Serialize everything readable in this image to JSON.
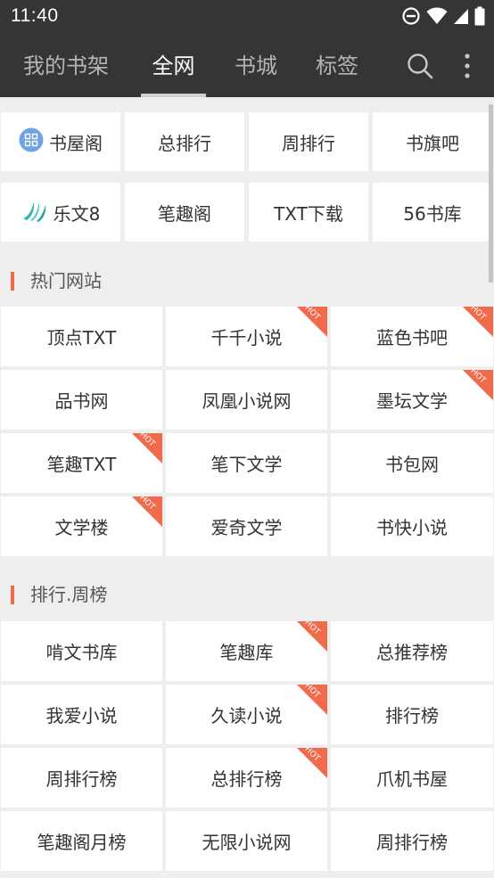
{
  "status": {
    "time": "11:40"
  },
  "tabs": [
    {
      "label": "我的书架"
    },
    {
      "label": "全网"
    },
    {
      "label": "书城"
    },
    {
      "label": "标签"
    }
  ],
  "top_sources": [
    {
      "label": "书屋阁",
      "logo": "grid-logo-icon"
    },
    {
      "label": "总排行"
    },
    {
      "label": "周排行"
    },
    {
      "label": "书旗吧"
    },
    {
      "label": "乐文8",
      "logo": "leaf-logo-icon"
    },
    {
      "label": "笔趣阁"
    },
    {
      "label": "TXT下载"
    },
    {
      "label": "56书库"
    }
  ],
  "sections": [
    {
      "title": "热门网站",
      "items": [
        {
          "label": "顶点TXT",
          "hot": false
        },
        {
          "label": "千千小说",
          "hot": true
        },
        {
          "label": "蓝色书吧",
          "hot": true
        },
        {
          "label": "品书网",
          "hot": false
        },
        {
          "label": "凤凰小说网",
          "hot": false
        },
        {
          "label": "墨坛文学",
          "hot": true
        },
        {
          "label": "笔趣TXT",
          "hot": true
        },
        {
          "label": "笔下文学",
          "hot": false
        },
        {
          "label": "书包网",
          "hot": false
        },
        {
          "label": "文学楼",
          "hot": true
        },
        {
          "label": "爱奇文学",
          "hot": false
        },
        {
          "label": "书快小说",
          "hot": false
        }
      ]
    },
    {
      "title": "排行.周榜",
      "items": [
        {
          "label": "啃文书库",
          "hot": false
        },
        {
          "label": "笔趣库",
          "hot": true
        },
        {
          "label": "总推荐榜",
          "hot": false
        },
        {
          "label": "我爱小说",
          "hot": false
        },
        {
          "label": "久读小说",
          "hot": true
        },
        {
          "label": "排行榜",
          "hot": false
        },
        {
          "label": "周排行榜",
          "hot": false
        },
        {
          "label": "总排行榜",
          "hot": true
        },
        {
          "label": "爪机书屋",
          "hot": false
        },
        {
          "label": "笔趣阁月榜",
          "hot": false
        },
        {
          "label": "无限小说网",
          "hot": false
        },
        {
          "label": "周排行榜",
          "hot": false
        }
      ]
    }
  ],
  "badge": {
    "hot": "HOT"
  },
  "colors": {
    "toolbar": "#353535",
    "accent": "#ef6a4a",
    "background": "#eeeeee"
  }
}
